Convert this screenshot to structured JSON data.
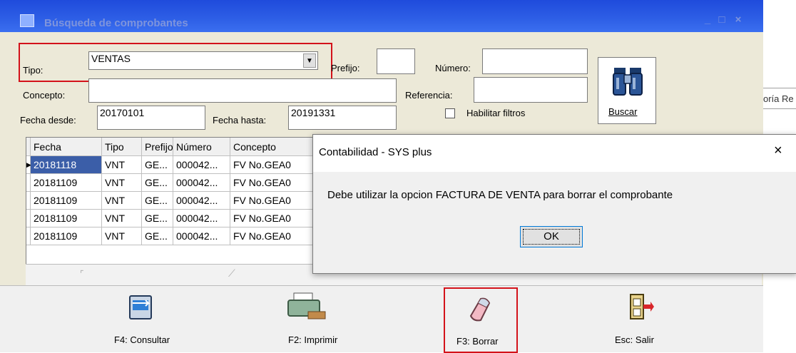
{
  "window": {
    "title": "Búsqueda de comprobantes",
    "minimize": "_",
    "maximize": "□",
    "close": "×"
  },
  "form": {
    "tipo_label": "Tipo:",
    "tipo_value": "VENTAS",
    "prefijo_label": "Prefijo:",
    "prefijo_value": "",
    "numero_label": "Número:",
    "numero_value": "",
    "concepto_label": "Concepto:",
    "concepto_value": "",
    "referencia_label": "Referencia:",
    "referencia_value": "",
    "fecha_desde_label": "Fecha desde:",
    "fecha_desde_value": "20170101",
    "fecha_hasta_label": "Fecha hasta:",
    "fecha_hasta_value": "20191331",
    "habilitar_filtros_label": "Habilitar filtros",
    "habilitar_filtros_checked": false,
    "buscar_label": "Buscar"
  },
  "grid": {
    "columns": [
      "Fecha",
      "Tipo",
      "Prefijo",
      "Número",
      "Concepto"
    ],
    "rows": [
      {
        "fecha": "20181118",
        "tipo": "VNT",
        "prefijo": "GE...",
        "numero": "000042...",
        "concepto": "FV No.GEA0",
        "selected": true
      },
      {
        "fecha": "20181109",
        "tipo": "VNT",
        "prefijo": "GE...",
        "numero": "000042...",
        "concepto": "FV No.GEA0",
        "selected": false
      },
      {
        "fecha": "20181109",
        "tipo": "VNT",
        "prefijo": "GE...",
        "numero": "000042...",
        "concepto": "FV No.GEA0",
        "selected": false
      },
      {
        "fecha": "20181109",
        "tipo": "VNT",
        "prefijo": "GE...",
        "numero": "000042...",
        "concepto": "FV No.GEA0",
        "selected": false
      },
      {
        "fecha": "20181109",
        "tipo": "VNT",
        "prefijo": "GE...",
        "numero": "000042...",
        "concepto": "FV No.GEA0",
        "selected": false
      }
    ]
  },
  "background_grid_header": "oría Re",
  "toolbar": {
    "consultar": "F4: Consultar",
    "imprimir": "F2: Imprimir",
    "borrar": "F3: Borrar",
    "salir": "Esc: Salir"
  },
  "dialog": {
    "title": "Contabilidad - SYS plus",
    "close": "×",
    "message": "Debe utilizar la opcion FACTURA DE VENTA para borrar el comprobante",
    "ok_label": "OK"
  },
  "colors": {
    "titlebar": "#2e5fe6",
    "highlight_red": "#d3121a",
    "selected_row": "#3b5ea8"
  }
}
